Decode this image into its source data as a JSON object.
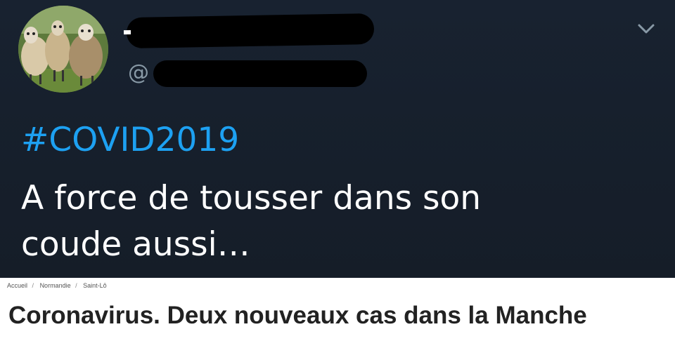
{
  "tweet": {
    "avatar_icon": "sheep-avatar-icon",
    "display_name": "",
    "handle_prefix": "@",
    "handle": "",
    "menu_icon": "chevron-down-icon",
    "hashtag": "#COVID2019",
    "text_line1": "A force de tousser dans son",
    "text_line2": "coude aussi…",
    "colors": {
      "background": "#151d28",
      "hashtag": "#1da1f2",
      "text": "#ffffff",
      "muted": "#8899a6"
    }
  },
  "article": {
    "breadcrumb": [
      "Accueil",
      "Normandie",
      "Saint-Lô"
    ],
    "breadcrumb_separator": "/",
    "headline": "Coronavirus. Deux nouveaux cas dans la Manche"
  }
}
